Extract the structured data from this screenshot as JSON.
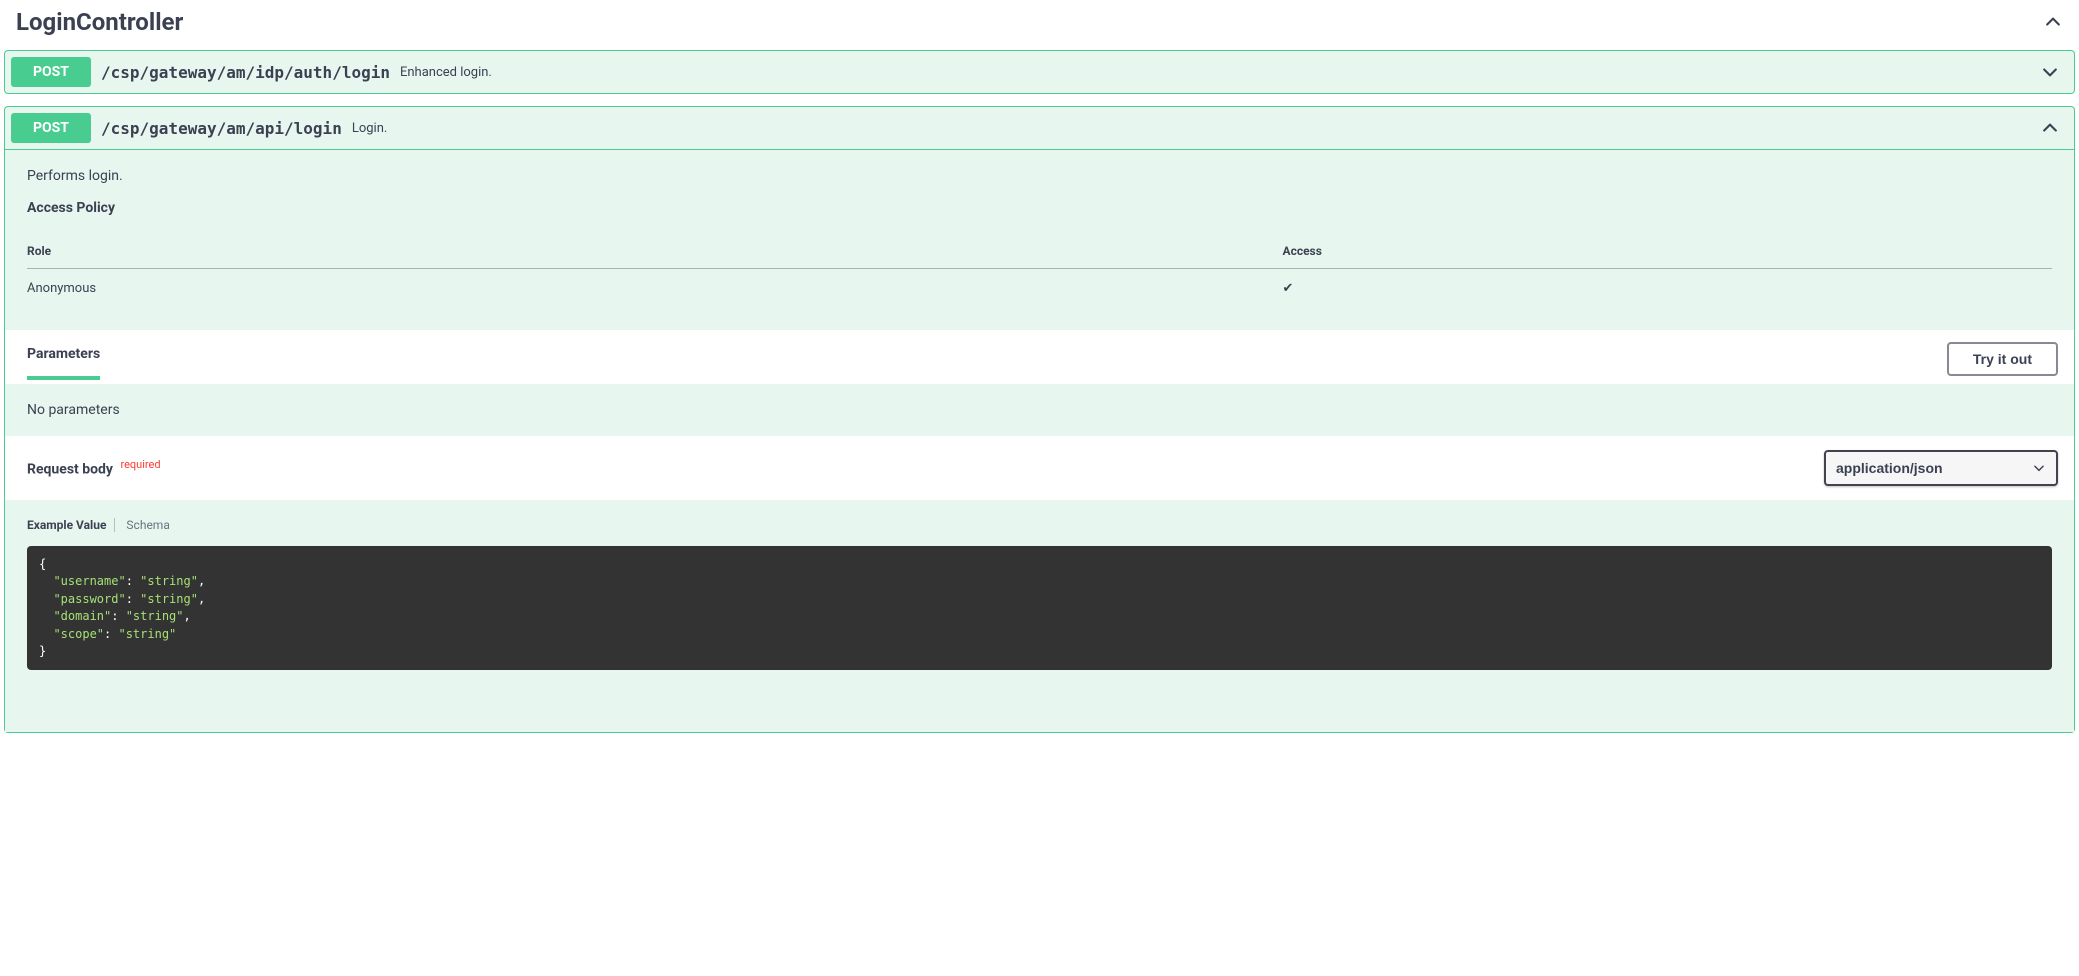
{
  "section": {
    "title": "LoginController"
  },
  "endpoints": [
    {
      "method": "POST",
      "path": "/csp/gateway/am/idp/auth/login",
      "summary": "Enhanced login.",
      "expanded": false
    },
    {
      "method": "POST",
      "path": "/csp/gateway/am/api/login",
      "summary": "Login.",
      "expanded": true,
      "description": "Performs login.",
      "access_policy": {
        "title": "Access Policy",
        "headers": {
          "role": "Role",
          "access": "Access"
        },
        "rows": [
          {
            "role": "Anonymous",
            "access": "✔"
          }
        ]
      },
      "parameters": {
        "label": "Parameters",
        "tryout": "Try it out",
        "empty_text": "No parameters"
      },
      "request_body": {
        "label": "Request body",
        "required_label": "required",
        "content_type": "application/json",
        "tabs": {
          "example": "Example Value",
          "schema": "Schema"
        },
        "example": {
          "fields": [
            {
              "key": "username",
              "value": "string"
            },
            {
              "key": "password",
              "value": "string"
            },
            {
              "key": "domain",
              "value": "string"
            },
            {
              "key": "scope",
              "value": "string"
            }
          ]
        }
      }
    }
  ]
}
